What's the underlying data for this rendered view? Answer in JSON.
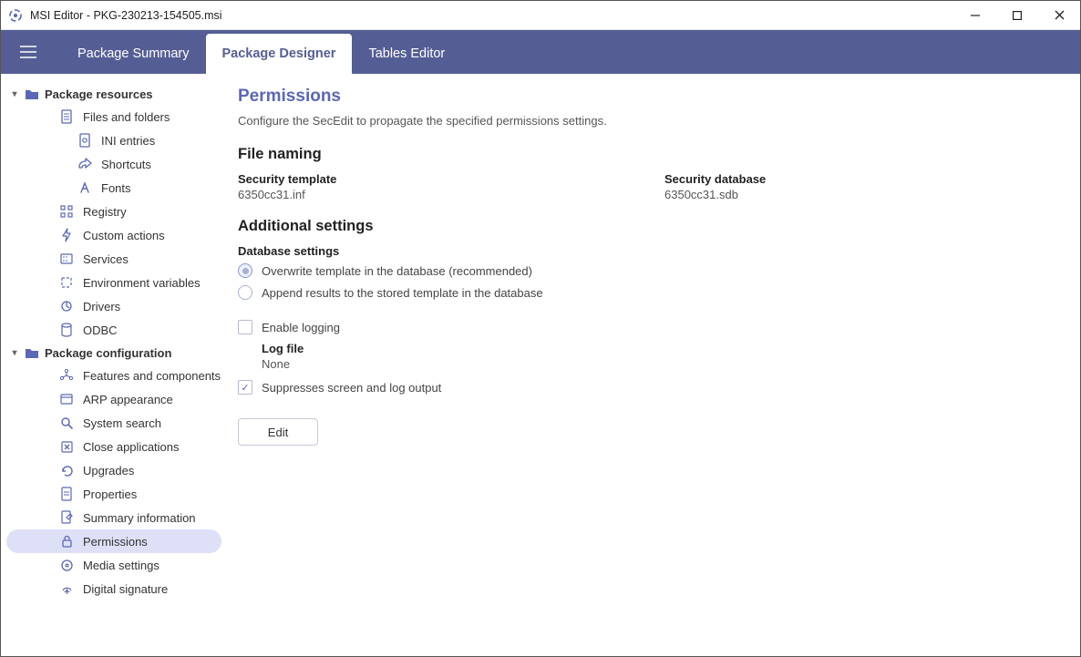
{
  "titlebar": {
    "title": "MSI Editor - PKG-230213-154505.msi"
  },
  "tabs": {
    "summary": "Package Summary",
    "designer": "Package Designer",
    "tables": "Tables Editor"
  },
  "sidebar": {
    "group_resources": "Package resources",
    "files_folders": "Files and folders",
    "ini": "INI entries",
    "shortcuts": "Shortcuts",
    "fonts": "Fonts",
    "registry": "Registry",
    "custom_actions": "Custom actions",
    "services": "Services",
    "env_vars": "Environment variables",
    "drivers": "Drivers",
    "odbc": "ODBC",
    "group_config": "Package configuration",
    "features": "Features and components",
    "arp": "ARP appearance",
    "system_search": "System search",
    "close_apps": "Close applications",
    "upgrades": "Upgrades",
    "properties": "Properties",
    "summary_info": "Summary information",
    "permissions": "Permissions",
    "media": "Media settings",
    "digital_sig": "Digital signature"
  },
  "content": {
    "title": "Permissions",
    "subtitle": "Configure the SecEdit to propagate the specified permissions settings.",
    "file_naming_h": "File naming",
    "sec_template_lbl": "Security template",
    "sec_template_val": "6350cc31.inf",
    "sec_db_lbl": "Security database",
    "sec_db_val": "6350cc31.sdb",
    "additional_h": "Additional settings",
    "db_settings_lbl": "Database settings",
    "radio_overwrite": "Overwrite template in the database (recommended)",
    "radio_append": "Append results to the stored template in the database",
    "chk_logging": "Enable logging",
    "log_file_lbl": "Log file",
    "log_file_val": "None",
    "chk_suppress": "Suppresses screen and log output",
    "edit_btn": "Edit"
  }
}
